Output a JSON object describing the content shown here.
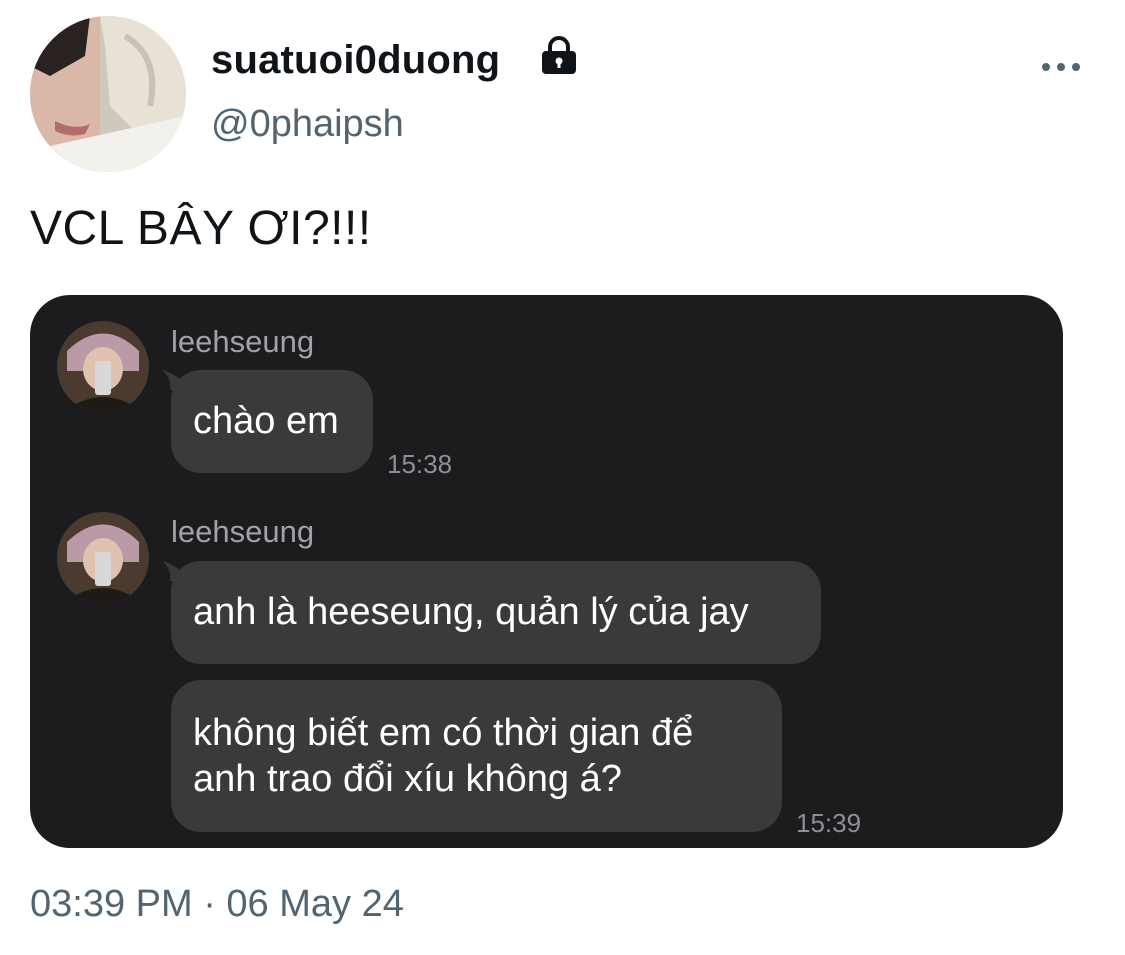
{
  "author": {
    "display_name": "suatuoi0duong",
    "handle": "@0phaipsh",
    "avatar_icon": "profile-photo",
    "protected_icon": "lock-icon"
  },
  "header": {
    "more_icon": "more-horizontal-icon"
  },
  "tweet": {
    "text": "VCL BÂY ƠI?!!!",
    "timestamp": "03:39 PM · 06 May 24"
  },
  "chat": {
    "messages": [
      {
        "sender": "leehseung",
        "bubbles": [
          "chào em"
        ],
        "time": "15:38"
      },
      {
        "sender": "leehseung",
        "bubbles": [
          "anh là heeseung, quản lý của jay",
          "không biết em có thời gian để\nanh trao đổi xíu không á?"
        ],
        "time": "15:39"
      }
    ]
  },
  "colors": {
    "card_background": "#1c1c1e",
    "bubble_background": "#3a3a3c",
    "secondary_text": "#536471"
  }
}
